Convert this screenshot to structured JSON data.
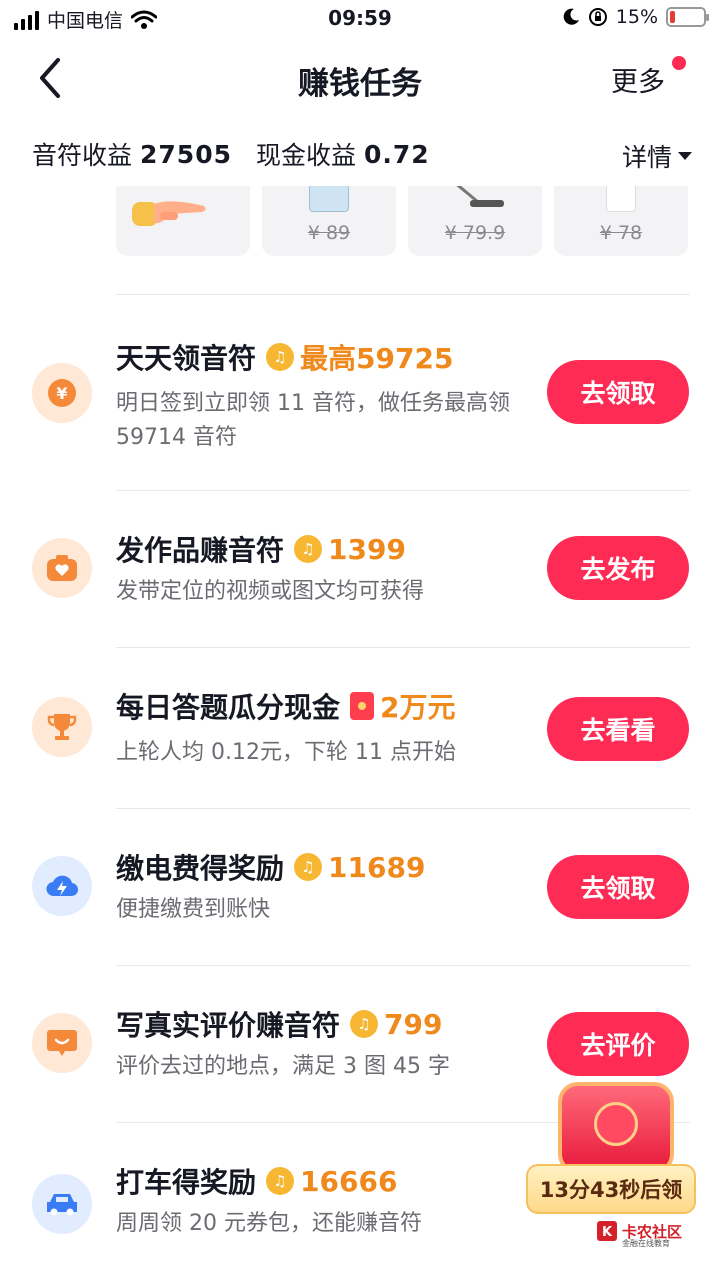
{
  "status_bar": {
    "carrier": "中国电信",
    "time": "09:59",
    "battery": "15%",
    "battery_level": 0.15
  },
  "header": {
    "title": "赚钱任务",
    "more_label": "更多"
  },
  "earnings": {
    "notes_label": "音符收益",
    "notes_value": "27505",
    "cash_label": "现金收益",
    "cash_value": "0.72",
    "details_label": "详情"
  },
  "products": [
    {
      "price": ""
    },
    {
      "price": "¥ 89"
    },
    {
      "price": "¥ 79.9"
    },
    {
      "price": "¥ 78"
    }
  ],
  "tasks": [
    {
      "title": "天天领音符",
      "reward": "最高59725",
      "desc": "明日签到立即领 11 音符，做任务最高领 59714 音符",
      "button": "去领取",
      "icon": "yen-icon"
    },
    {
      "title": "发作品赚音符",
      "reward": "1399",
      "desc": "发带定位的视频或图文均可获得",
      "button": "去发布",
      "icon": "camera-heart-icon"
    },
    {
      "title": "每日答题瓜分现金",
      "reward": "2万元",
      "desc": "上轮人均 0.12元，下轮 11 点开始",
      "button": "去看看",
      "icon": "trophy-icon"
    },
    {
      "title": "缴电费得奖励",
      "reward": "11689",
      "desc": "便捷缴费到账快",
      "button": "去领取",
      "icon": "lightning-cloud-icon"
    },
    {
      "title": "写真实评价赚音符",
      "reward": "799",
      "desc": "评价去过的地点，满足 3 图 45 字",
      "button": "去评价",
      "icon": "comment-icon"
    },
    {
      "title": "打车得奖励",
      "reward": "16666",
      "desc": "周周领 20 元券包，还能赚音符",
      "button": "",
      "icon": "car-icon"
    }
  ],
  "floating": {
    "timer": "13分43秒后领"
  },
  "watermark": {
    "name": "卡农社区",
    "sub": "金融在线教育"
  },
  "colors": {
    "accent": "#fe2c55",
    "reward": "#f0891c",
    "note": "#f7b733"
  }
}
